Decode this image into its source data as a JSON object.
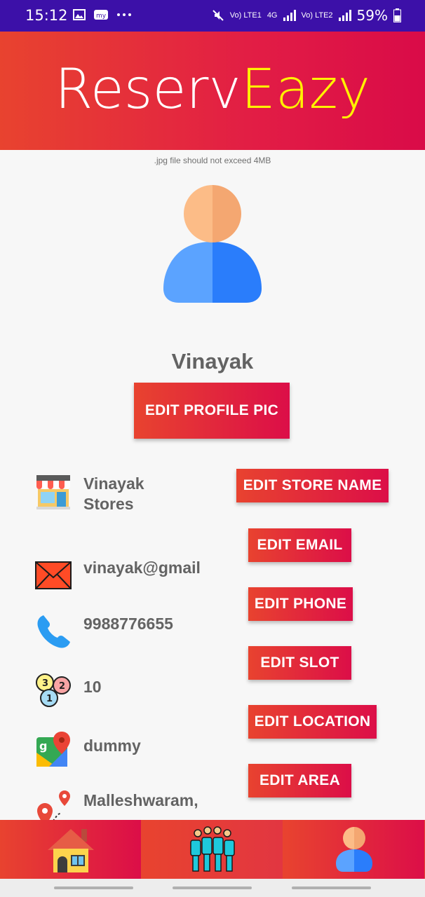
{
  "status_bar": {
    "time": "15:12",
    "network_left": "Vo) LTE1",
    "network_type": "4G",
    "network_right": "Vo) LTE2",
    "battery": "59%"
  },
  "header": {
    "logo_part1": "Reserv",
    "logo_part2": "Eazy"
  },
  "profile": {
    "file_note": ".jpg file should not exceed 4MB",
    "name": "Vinayak",
    "edit_pic_label": "EDIT PROFILE PIC"
  },
  "details": [
    {
      "icon": "store-icon",
      "value": "Vinayak\nStores",
      "button": "EDIT STORE NAME"
    },
    {
      "icon": "email-icon",
      "value": "vinayak@gmail",
      "button": "EDIT EMAIL"
    },
    {
      "icon": "phone-icon",
      "value": "9988776655",
      "button": "EDIT PHONE"
    },
    {
      "icon": "queue-numbers-icon",
      "value": "10",
      "button": "EDIT SLOT"
    },
    {
      "icon": "google-maps-icon",
      "value": "dummy",
      "button": "EDIT LOCATION"
    },
    {
      "icon": "route-pin-icon",
      "value": "Malleshwaram,",
      "button": "EDIT AREA"
    }
  ],
  "bottom_nav": [
    {
      "icon": "home-icon"
    },
    {
      "icon": "people-queue-icon"
    },
    {
      "icon": "profile-icon"
    }
  ],
  "colors": {
    "status_bar": "#3c10a8",
    "accent_start": "#e8432f",
    "accent_end": "#dc0e48",
    "logo_highlight": "#fff200"
  }
}
